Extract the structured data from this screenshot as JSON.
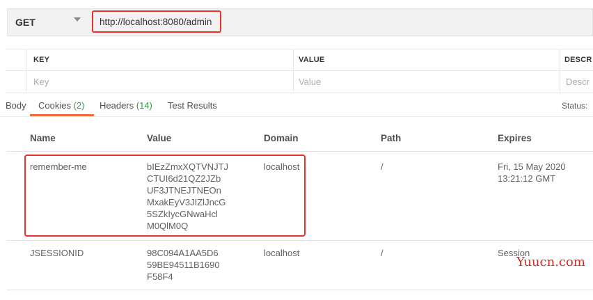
{
  "request": {
    "method": "GET",
    "url": "http://localhost:8080/admin"
  },
  "params": {
    "headers": [
      "KEY",
      "VALUE",
      "DESCR"
    ],
    "placeholders": [
      "Key",
      "Value",
      "Descr"
    ]
  },
  "tabs": [
    {
      "label": "Body",
      "count": ""
    },
    {
      "label": "Cookies",
      "count": "(2)"
    },
    {
      "label": "Headers",
      "count": "(14)"
    },
    {
      "label": "Test Results",
      "count": ""
    }
  ],
  "active_tab": "Cookies",
  "status_label": "Status:",
  "cookies": {
    "columns": [
      "Name",
      "Value",
      "Domain",
      "Path",
      "Expires"
    ],
    "rows": [
      {
        "name": "remember-me",
        "value_lines": [
          "bIEzZmxXQTVNJTJ",
          "CTUI6d21QZ2JZb",
          "UF3JTNEJTNEOn",
          "MxakEyV3JIZlJncG",
          "5SZkIycGNwaHcl",
          "M0QlM0Q"
        ],
        "domain": "localhost",
        "path": "/",
        "expires_lines": [
          "Fri, 15 May 2020",
          "13:21:12 GMT"
        ]
      },
      {
        "name": "JSESSIONID",
        "value_lines": [
          "98C094A1AA5D6",
          "59BE94511B1690",
          "F58F4"
        ],
        "domain": "localhost",
        "path": "/",
        "expires_lines": [
          "Session"
        ]
      }
    ]
  },
  "watermark": "Yuucn.com",
  "colors": {
    "highlight": "#e8322c",
    "tab_accent": "#f26b3a",
    "count_green": "#2e9e41"
  }
}
